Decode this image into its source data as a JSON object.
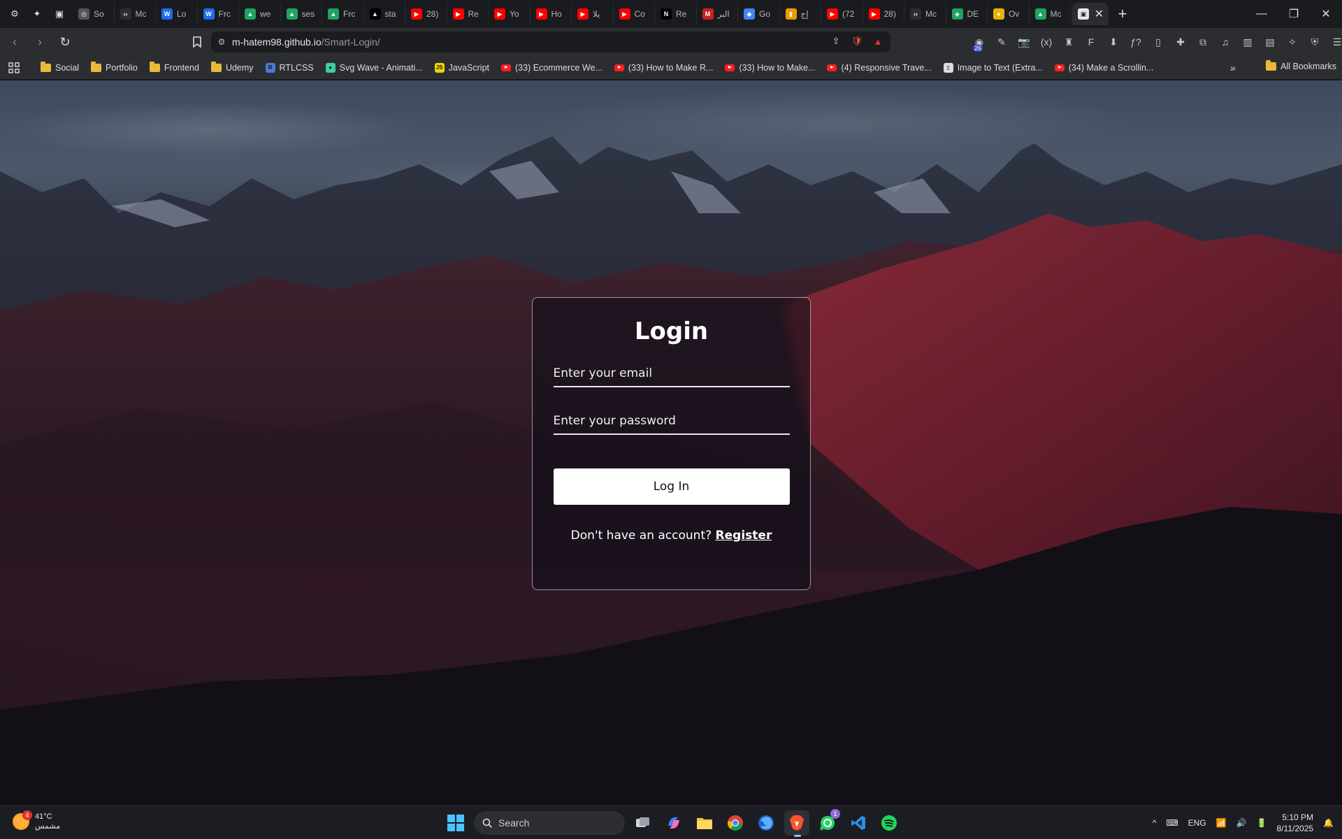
{
  "browser": {
    "pinned_tabs": [
      {
        "name": "settings-icon",
        "glyph": "⚙"
      },
      {
        "name": "leo-ai-icon",
        "glyph": "✦"
      },
      {
        "name": "wallet-icon",
        "glyph": "▣"
      }
    ],
    "tabs": [
      {
        "label": "So",
        "icon": "circle-icon",
        "color": "#555555",
        "glyph": "◎"
      },
      {
        "label": "Mc",
        "icon": "code-icon",
        "color": "#2c2d31",
        "glyph": "‹›"
      },
      {
        "label": "Lo",
        "icon": "w-logo-icon",
        "color": "#1e6cf0",
        "glyph": "W"
      },
      {
        "label": "Frc",
        "icon": "w-logo-icon",
        "color": "#1e6cf0",
        "glyph": "W"
      },
      {
        "label": "we",
        "icon": "drive-icon",
        "color": "#1fa463",
        "glyph": "▲"
      },
      {
        "label": "ses",
        "icon": "drive-icon",
        "color": "#1fa463",
        "glyph": "▲"
      },
      {
        "label": "Frc",
        "icon": "drive-icon",
        "color": "#1fa463",
        "glyph": "▲"
      },
      {
        "label": "sta",
        "icon": "triangle-logo-icon",
        "color": "#000000",
        "glyph": "▲"
      },
      {
        "label": "28)",
        "icon": "youtube-icon",
        "color": "#ff0000",
        "glyph": "▶"
      },
      {
        "label": "Re",
        "icon": "youtube-icon",
        "color": "#ff0000",
        "glyph": "▶"
      },
      {
        "label": "Yo",
        "icon": "youtube-icon",
        "color": "#ff0000",
        "glyph": "▶"
      },
      {
        "label": "Ho",
        "icon": "youtube-icon",
        "color": "#ff0000",
        "glyph": "▶"
      },
      {
        "label": "يلا",
        "icon": "youtube-icon",
        "color": "#ff0000",
        "glyph": "▶"
      },
      {
        "label": "Co",
        "icon": "youtube-icon",
        "color": "#ff0000",
        "glyph": "▶"
      },
      {
        "label": "Re",
        "icon": "next-logo-icon",
        "color": "#000000",
        "glyph": "N"
      },
      {
        "label": "البر",
        "icon": "gmail-icon",
        "color": "#c5221f",
        "glyph": "M"
      },
      {
        "label": "Go",
        "icon": "google-icon",
        "color": "#4285f4",
        "glyph": "◆"
      },
      {
        "label": "إج",
        "icon": "chart-icon",
        "color": "#f29900",
        "glyph": "▮"
      },
      {
        "label": "(72",
        "icon": "youtube-icon",
        "color": "#ff0000",
        "glyph": "▶"
      },
      {
        "label": "28)",
        "icon": "youtube-icon",
        "color": "#ff0000",
        "glyph": "▶"
      },
      {
        "label": "Mc",
        "icon": "code-icon",
        "color": "#2c2d31",
        "glyph": "‹›"
      },
      {
        "label": "DE",
        "icon": "shield-icon",
        "color": "#1fa463",
        "glyph": "◈"
      },
      {
        "label": "Ov",
        "icon": "chrome-icon",
        "color": "#e8b400",
        "glyph": "●"
      },
      {
        "label": "Mc",
        "icon": "drive-icon",
        "color": "#1fa463",
        "glyph": "▲"
      }
    ],
    "active_tab": {
      "icon": "page-icon",
      "close_glyph": "✕"
    },
    "new_tab_glyph": "+",
    "window_controls": {
      "minimize": "—",
      "maximize": "❐",
      "close": "✕"
    },
    "nav": {
      "back": "‹",
      "forward": "›",
      "reload": "↻"
    },
    "url": {
      "host": "m-hatem98.github.io",
      "path": "/Smart-Login/"
    },
    "extensions": [
      "◉",
      "✎",
      "📷",
      "(x)",
      "♜",
      "F",
      "⬇",
      "ƒ?",
      "▯",
      "✚",
      "⧉",
      "♫",
      "▥",
      "▤",
      "✧",
      "⛨",
      "☰"
    ],
    "extension_badge": "26"
  },
  "bookmarks": {
    "items": [
      {
        "label": "Social",
        "type": "folder"
      },
      {
        "label": "Portfolio",
        "type": "folder"
      },
      {
        "label": "Frontend",
        "type": "folder"
      },
      {
        "label": "Udemy",
        "type": "folder"
      },
      {
        "label": "RTLCSS",
        "type": "site",
        "color": "#4a7bd0",
        "glyph": "R"
      },
      {
        "label": "Svg Wave - Animati...",
        "type": "site",
        "color": "#3ad0a0",
        "glyph": "●"
      },
      {
        "label": "JavaScript",
        "type": "site",
        "color": "#f0d400",
        "glyph": "JS"
      },
      {
        "label": "(33) Ecommerce We...",
        "type": "youtube"
      },
      {
        "label": "(33) How to Make R...",
        "type": "youtube"
      },
      {
        "label": "(33) How to Make...",
        "type": "youtube"
      },
      {
        "label": "(4) Responsive Trave...",
        "type": "youtube"
      },
      {
        "label": "Image to Text (Extra...",
        "type": "site",
        "color": "#dddddd",
        "glyph": "▯"
      },
      {
        "label": "(34) Make a Scrollin...",
        "type": "youtube"
      }
    ],
    "more_glyph": "»",
    "all_bookmarks": "All Bookmarks"
  },
  "login": {
    "title": "Login",
    "email_placeholder": "Enter your email",
    "password_placeholder": "Enter your password",
    "button": "Log In",
    "register_prompt": "Don't have an account?",
    "register_link": "Register"
  },
  "taskbar": {
    "weather": {
      "temp": "41°C",
      "condition": "مشمس",
      "badge": "4"
    },
    "search": "Search",
    "whatsapp_badge": "1",
    "tray": {
      "chevron": "^",
      "language": "ENG"
    },
    "time": "5:10 PM",
    "date": "8/11/2025"
  },
  "colors": {
    "accent": "#4cc2ff",
    "card_border": "#ffffff",
    "button_bg": "#ffffff"
  }
}
